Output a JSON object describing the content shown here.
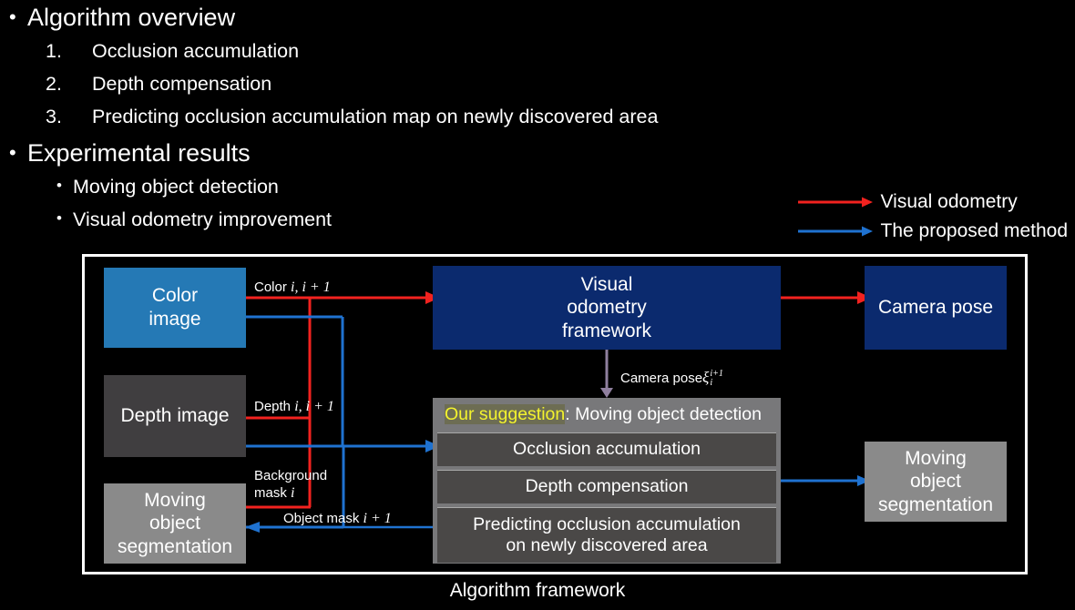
{
  "slide": {
    "background": "#000000",
    "bullets": [
      {
        "level": 1,
        "marker": "•",
        "text": "Algorithm overview"
      },
      {
        "level": 2,
        "marker": "1.",
        "text": "Occlusion accumulation"
      },
      {
        "level": 2,
        "marker": "2.",
        "text": "Depth compensation"
      },
      {
        "level": 2,
        "marker": "3.",
        "text": "Predicting occlusion accumulation map on newly discovered area"
      },
      {
        "level": 1,
        "marker": "•",
        "text": "Experimental results"
      },
      {
        "level": 3,
        "marker": "•",
        "text": "Moving object detection"
      },
      {
        "level": 3,
        "marker": "•",
        "text": "Visual odometry improvement"
      }
    ]
  },
  "legend": {
    "items": [
      {
        "label": "Visual odometry",
        "color": "#f2221f",
        "icon": "arrow-right-icon"
      },
      {
        "label": "The proposed method",
        "color": "#1f72d0",
        "icon": "arrow-right-icon"
      }
    ]
  },
  "diagram": {
    "caption": "Algorithm framework",
    "frame_border_color": "#ffffff",
    "boxes": {
      "color_image": {
        "label": "Color\nimage",
        "line1": "Color",
        "line2": "image",
        "color": "#2579b5"
      },
      "depth_image": {
        "label": "Depth image",
        "color": "#403e40"
      },
      "moving_object_segmentation_in": {
        "line1": "Moving",
        "line2": "object",
        "line3": "segmentation",
        "color": "#8a8a8a"
      },
      "visual_odometry_framework": {
        "line1": "Visual",
        "line2": "odometry",
        "line3": "framework",
        "color": "#0b2a6e"
      },
      "camera_pose": {
        "label": "Camera pose",
        "color": "#0b2a6e"
      },
      "moving_object_segmentation_out": {
        "line1": "Moving",
        "line2": "object",
        "line3": "segmentation",
        "color": "#8a8a8a"
      }
    },
    "suggestion_box": {
      "highlight": "Our suggestion",
      "highlight_color": "#f3f32e",
      "title_rest": ": Moving object detection",
      "steps": [
        {
          "line1": "Occlusion accumulation",
          "line2": ""
        },
        {
          "line1": "Depth compensation",
          "line2": ""
        },
        {
          "line1": "Predicting occlusion accumulation",
          "line2": "on newly discovered area"
        }
      ]
    },
    "edge_labels": {
      "color_pair": {
        "text": "Color",
        "math": "i, i + 1"
      },
      "depth_pair": {
        "text": "Depth",
        "math": "i, i + 1"
      },
      "background_mask": {
        "line1": "Background",
        "line2": "mask",
        "math": "i"
      },
      "object_mask": {
        "text": "Object mask",
        "math": "i + 1"
      },
      "camera_pose_xi": {
        "text": "Camera pose",
        "symbol": "ξ",
        "sup": "i+1",
        "sub": "i"
      }
    },
    "wire_colors": {
      "red": "#f2221f",
      "blue": "#1f72d0",
      "purple": "#8f7f9e"
    }
  }
}
